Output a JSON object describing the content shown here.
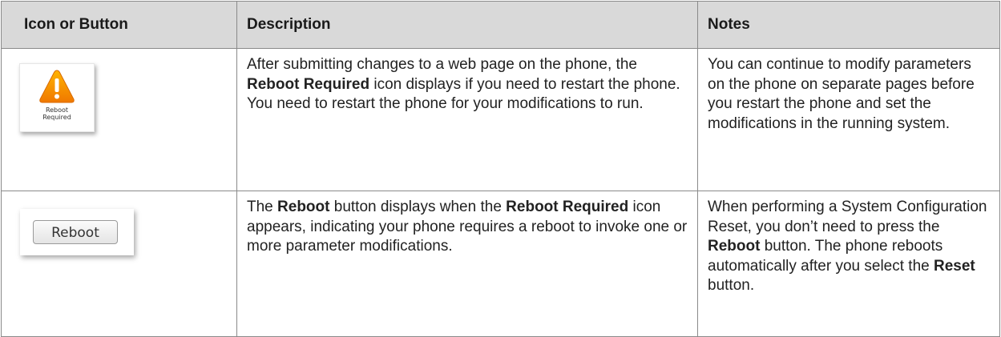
{
  "table": {
    "headers": [
      "Icon or Button",
      "Description",
      "Notes"
    ],
    "rows": [
      {
        "icon": {
          "name": "warning-icon",
          "label": "Reboot Required",
          "colors": {
            "triangle_top": "#ffb400",
            "triangle_bottom": "#f07800",
            "mark": "#ffffff"
          }
        },
        "description": {
          "t1": "After submitting changes to a web page on the phone, the ",
          "b1": "Reboot Required",
          "t2": " icon displays if you need to restart the phone. You need to restart the phone for your modifications to run."
        },
        "notes": {
          "t1": "You can continue to modify parameters on the phone on separate pages before you restart the phone and set the modifications in the running system."
        }
      },
      {
        "button": {
          "label": "Reboot"
        },
        "description": {
          "t1": "The ",
          "b1": "Reboot",
          "t2": " button displays when the ",
          "b2": "Reboot Required",
          "t3": " icon appears, indicating your phone requires a reboot to invoke one or more parameter modifications."
        },
        "notes": {
          "t1": "When performing a System Configuration Reset, you don’t need to press the ",
          "b1": "Reboot",
          "t2": " button. The phone reboots automatically after you select the ",
          "b2": "Reset",
          "t3": " button."
        }
      }
    ]
  }
}
